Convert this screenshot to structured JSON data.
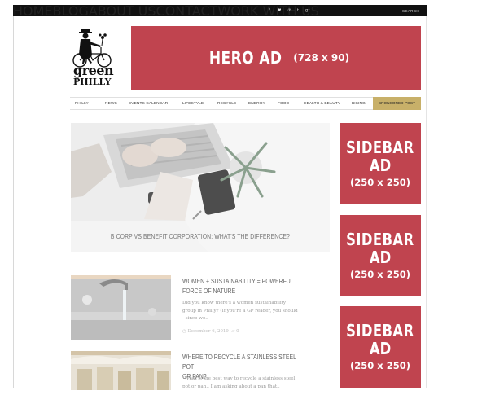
{
  "topbar": {
    "nav": [
      "HOME",
      "BLOG",
      "ABOUT US",
      "CONTACT",
      "WORK WITH US"
    ],
    "social_icons": [
      "facebook-icon",
      "twitter-icon",
      "pinterest-icon",
      "tumblr-icon",
      "googleplus-icon"
    ],
    "social_glyphs": [
      "f",
      "♥",
      "℗",
      "t",
      "g⁺"
    ],
    "search_label": "SEARCH"
  },
  "logo": {
    "line1": "green",
    "line2": "PHILLY"
  },
  "hero_ad": {
    "label": "HERO AD",
    "size": "(728 x 90)",
    "color": "#c0444f"
  },
  "main_nav": {
    "items": [
      "PHILLY",
      "NEWS",
      "EVENTS CALENDAR",
      "LIFESTYLE",
      "RECYCLE",
      "ENERGY",
      "FOOD",
      "HEALTH & BEAUTY",
      "BIKING"
    ],
    "sponsored": "SPONSORED POST",
    "sponsored_color": "#c8b069"
  },
  "feature": {
    "title": "B CORP VS BENEFIT CORPORATION: WHAT'S THE DIFFERENCE?"
  },
  "sidebar_ads": [
    {
      "line1": "SIDEBAR",
      "line2": "AD",
      "size": "(250 x 250)"
    },
    {
      "line1": "SIDEBAR",
      "line2": "AD",
      "size": "(250 x 250)"
    },
    {
      "line1": "SIDEBAR",
      "line2": "AD",
      "size": "(250 x 250)"
    }
  ],
  "articles": [
    {
      "title_line1": "WOMEN + SUSTAINABILITY = POWERFUL",
      "title_line2": "FORCE OF NATURE",
      "excerpt_line1": "Did you know there's a women sustainability",
      "excerpt_line2": "group in Philly? (If you're a GP reader, you should",
      "excerpt_line3": "- since we..",
      "date": "December 6, 2019",
      "comments": "0"
    },
    {
      "title_line1": "WHERE TO RECYCLE A STAINLESS STEEL POT",
      "title_line2": "OR PAN?",
      "excerpt_line1": "\"What is the best way to recycle a stainless steel",
      "excerpt_line2": "pot or pan.. I am asking about a pan that..",
      "excerpt_line3": "",
      "date": "",
      "comments": ""
    }
  ]
}
